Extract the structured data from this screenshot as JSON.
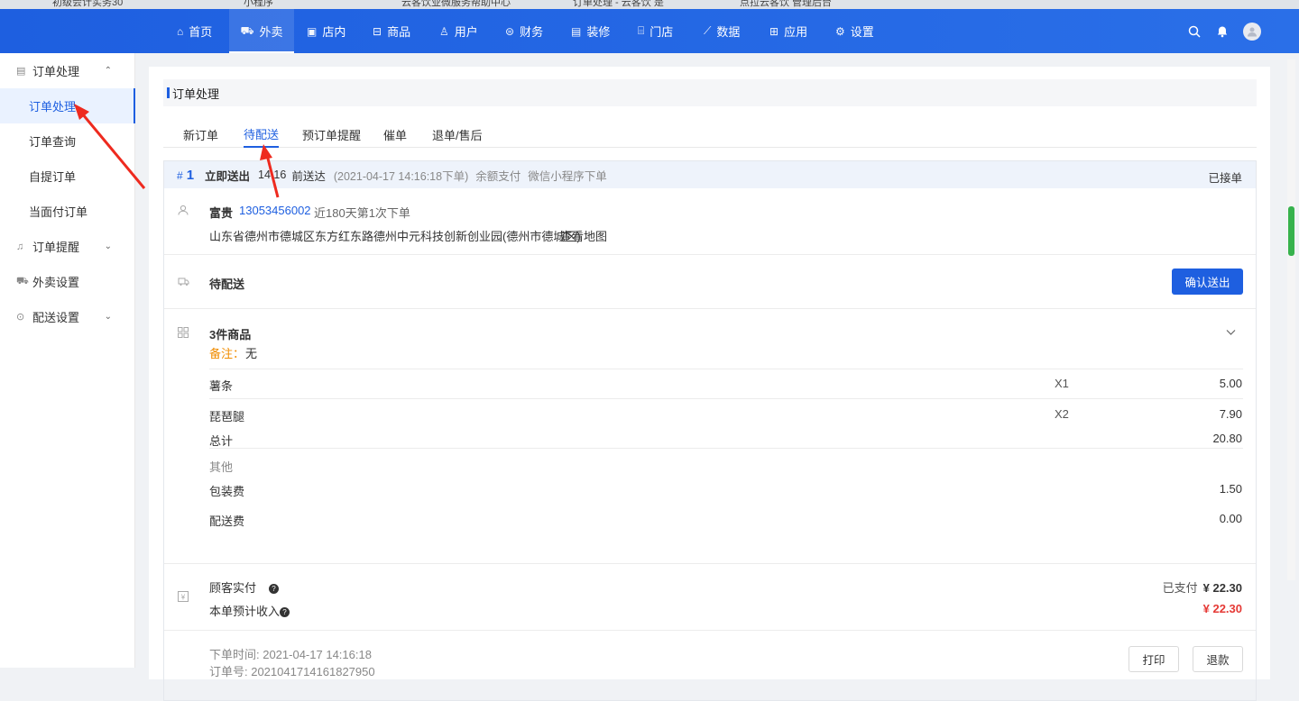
{
  "browser_tabs": [
    "初级会计实务30",
    "小程序",
    "云客饮业微服务帮助中心",
    "订单处理 - 云客饮 是",
    "点拉云客饮 管理后台"
  ],
  "topnav": {
    "items": [
      {
        "label": "首页",
        "icon": "⌂"
      },
      {
        "label": "外卖",
        "icon": "⛟"
      },
      {
        "label": "店内",
        "icon": "▣"
      },
      {
        "label": "商品",
        "icon": "⊟"
      },
      {
        "label": "用户",
        "icon": "♙"
      },
      {
        "label": "财务",
        "icon": "⊜"
      },
      {
        "label": "装修",
        "icon": "▤"
      },
      {
        "label": "门店",
        "icon": "⌸"
      },
      {
        "label": "数据",
        "icon": "⟋"
      },
      {
        "label": "应用",
        "icon": "⊞"
      },
      {
        "label": "设置",
        "icon": "⚙"
      }
    ],
    "active_index": 1
  },
  "sidebar": {
    "group_order": {
      "label": "订单处理",
      "icon": "▤",
      "chevron": "⌃"
    },
    "sub_items": [
      {
        "label": "订单处理"
      },
      {
        "label": "订单查询"
      },
      {
        "label": "自提订单"
      },
      {
        "label": "当面付订单"
      }
    ],
    "group_remind": {
      "label": "订单提醒",
      "icon": "♫",
      "chevron": "⌄"
    },
    "group_delivery_settings": {
      "label": "外卖设置",
      "icon": "⛟"
    },
    "group_dispatch_settings": {
      "label": "配送设置",
      "icon": "⊙",
      "chevron": "⌄"
    }
  },
  "page": {
    "section_title": "订单处理",
    "tabs": [
      "新订单",
      "待配送",
      "预订单提醒",
      "催单",
      "退单/售后"
    ],
    "active_tab": 1
  },
  "order": {
    "hash": "#",
    "number": "1",
    "delivery_type": "立即送出",
    "time": "14:16",
    "deliver_label": "前送达",
    "created": "(2021-04-17 14:16:18下单)",
    "pay_method": "余额支付",
    "source": "微信小程序下单",
    "status": "已接单",
    "customer": {
      "name": "富贵",
      "phone": "13053456002",
      "history": "近180天第1次下单",
      "address": "山东省德州市德城区东方红东路德州中元科技创新创业园(德州市德城区)",
      "map_link": "查看地图"
    },
    "dispatch": {
      "status": "待配送",
      "confirm_button": "确认送出"
    },
    "goods": {
      "count_label": "3件商品",
      "remark_label": "备注：",
      "remark_value": "无",
      "items": [
        {
          "name": "薯条",
          "qty": "X1",
          "price": "5.00"
        },
        {
          "name": "琵琶腿",
          "qty": "X2",
          "price": "7.90"
        }
      ],
      "total_label": "总计",
      "total_value": "20.80",
      "other_label": "其他",
      "packing_label": "包装费",
      "packing_value": "1.50",
      "delivery_fee_label": "配送费",
      "delivery_fee_value": "0.00"
    },
    "payment": {
      "paid_label": "顾客实付",
      "paid_status": "已支付",
      "paid_value": "¥ 22.30",
      "income_label": "本单预计收入",
      "income_value": "¥ 22.30"
    },
    "footer": {
      "order_time": "下单时间: 2021-04-17 14:16:18",
      "order_id": "订单号: 2021041714161827950",
      "print_button": "打印",
      "refund_button": "退款"
    }
  },
  "colors": {
    "primary": "#1e5fe0",
    "remark": "#f08c00",
    "income": "#e53935",
    "annotation_arrow": "#ee2a1f"
  }
}
